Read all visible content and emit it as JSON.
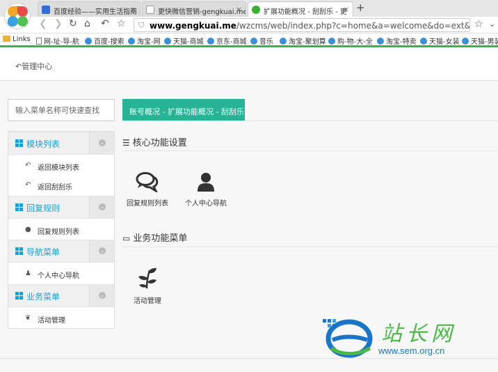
{
  "browser": {
    "tabs": [
      {
        "title": "百度经验——实用生活指南"
      },
      {
        "title": "更快微信营销-gengkuai.me"
      },
      {
        "title": "扩展功能概况 - 刮刮乐 - 更"
      }
    ],
    "new_tab": "+",
    "url_host": "www.gengkuai.me",
    "url_path": "/wzcms/web/index.php?c=home&a=welcome&do=ext&m=hx_ca",
    "bookmarks": [
      "Links",
      "网-址-导-航",
      "百度-搜索",
      "淘宝-网",
      "天猫-商城",
      "京东-商城",
      "音乐",
      "淘宝-聚划算",
      "购-物-大-全",
      "淘宝-特卖",
      "天猫-女装",
      "天猫-男装"
    ]
  },
  "header": {
    "mgmt_label": "管理中心"
  },
  "search": {
    "placeholder": "输入菜单名称可快速查找"
  },
  "breadcrumb": "账号概况 - 扩展功能概况 - 刮刮乐",
  "sidebar": {
    "sections": [
      {
        "title": "模块列表",
        "items": [
          "返回模块列表",
          "返回刮刮乐"
        ]
      },
      {
        "title": "回复规则",
        "items": [
          "回复规则列表"
        ]
      },
      {
        "title": "导航菜单",
        "items": [
          "个人中心导航"
        ]
      },
      {
        "title": "业务菜单",
        "items": [
          "活动管理"
        ]
      }
    ]
  },
  "main": {
    "core_title": "核心功能设置",
    "core_tiles": [
      "回复规则列表",
      "个人中心导航"
    ],
    "biz_title": "业务功能菜单",
    "biz_tiles": [
      "活动管理"
    ]
  },
  "watermark": {
    "name": "站长网",
    "url": "www.sem.org.cn"
  },
  "colors": {
    "accent": "#26b396",
    "link_blue": "#1a9fd6",
    "browser_green": "#37b34a"
  }
}
